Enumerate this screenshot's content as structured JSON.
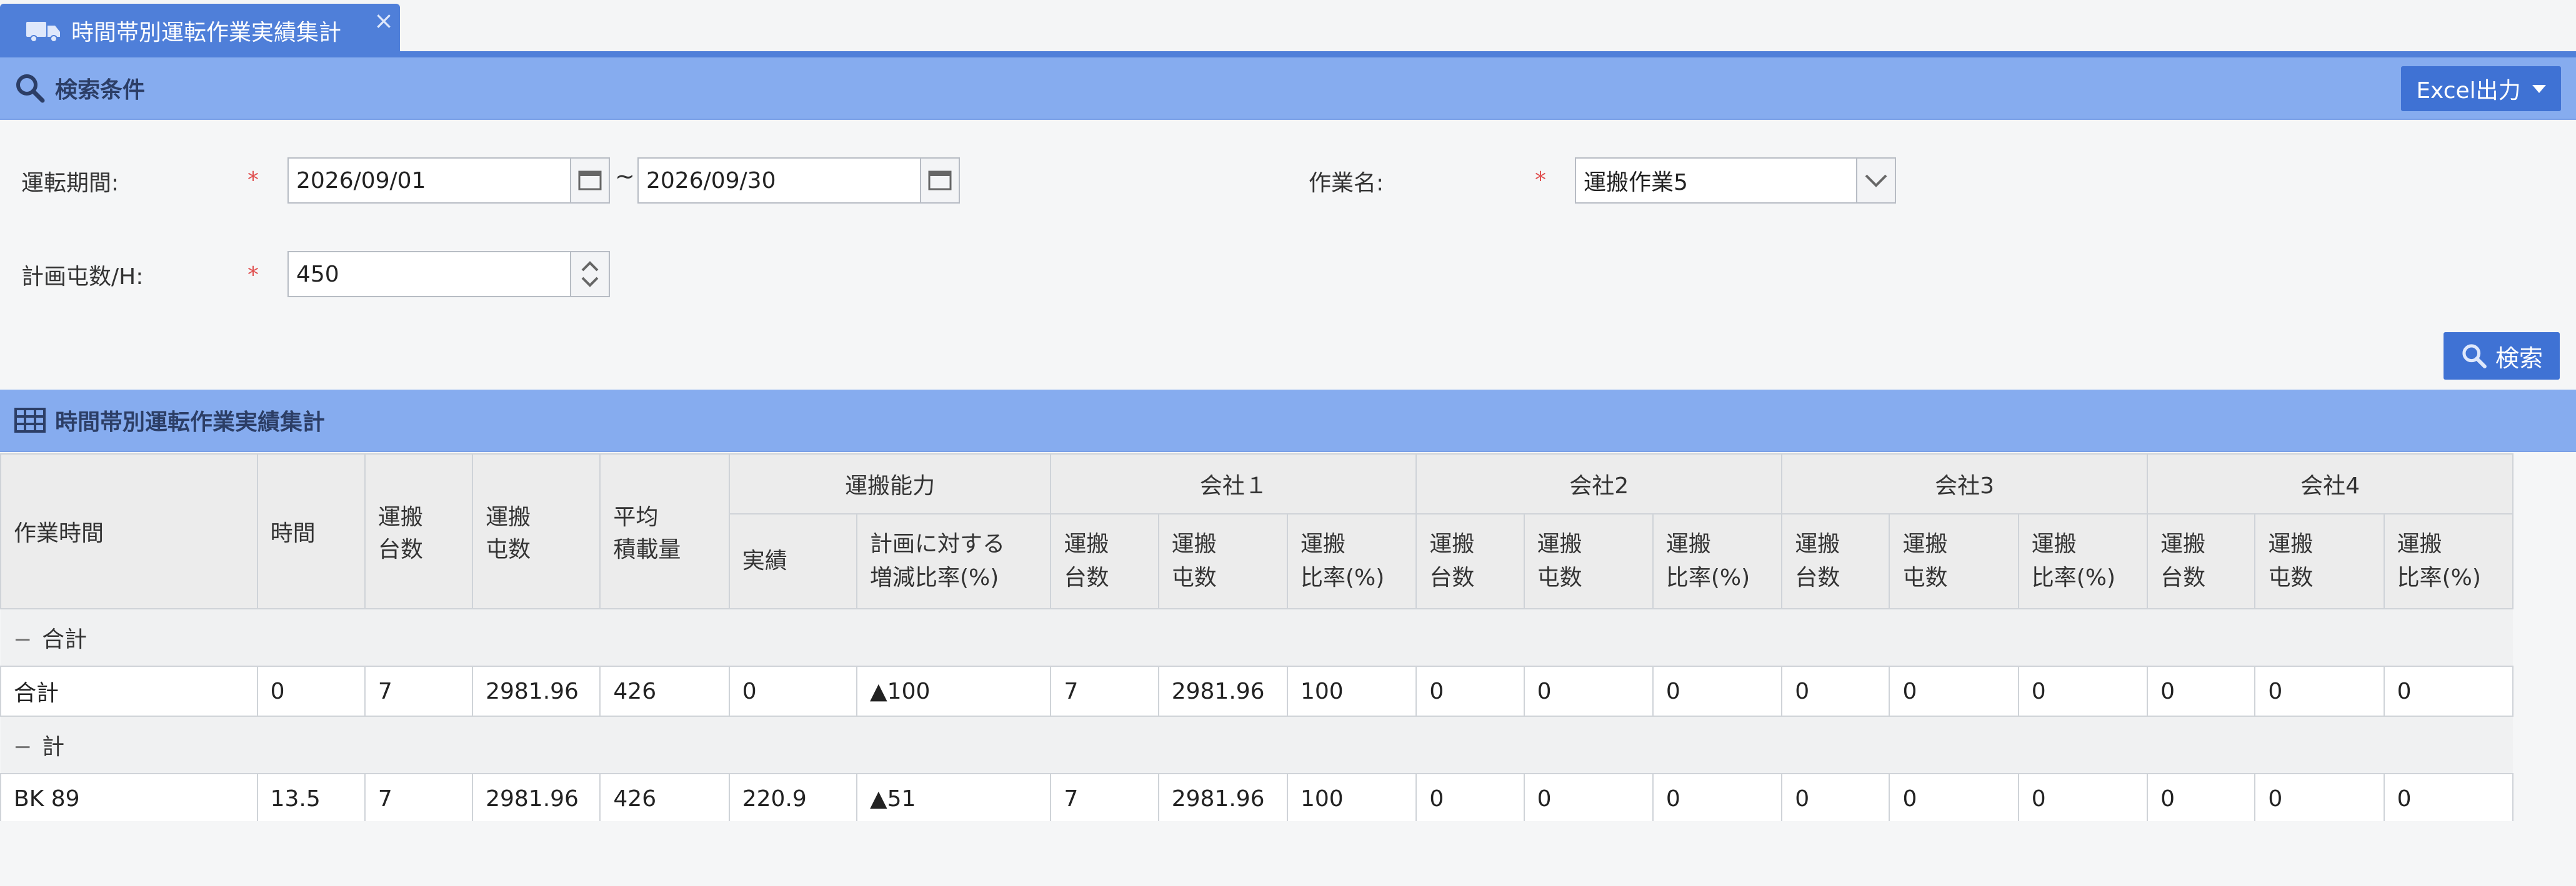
{
  "tab": {
    "title": "時間帯別運転作業実績集計",
    "close": "×"
  },
  "search_section": {
    "title": "検索条件",
    "excel_label": "Excel出力"
  },
  "form": {
    "period_label": "運転期間:",
    "period_from": "2026/09/01",
    "period_sep": "~",
    "period_to": "2026/09/30",
    "work_label": "作業名:",
    "work_value": "運搬作業5",
    "plan_label": "計画屯数/H:",
    "plan_value": "450",
    "required_mark": "*",
    "search_label": "検索"
  },
  "result_section": {
    "title": "時間帯別運転作業実績集計"
  },
  "table": {
    "headers": {
      "work_time": "作業時間",
      "hours": "時間",
      "count": [
        "運搬",
        "台数"
      ],
      "tons": [
        "運搬",
        "屯数"
      ],
      "avg": [
        "平均",
        "積載量"
      ],
      "capacity": "運搬能力",
      "actual": "実績",
      "ratio": [
        "計画に対する",
        "増減比率(%)"
      ],
      "companies": [
        "会社１",
        "会社2",
        "会社3",
        "会社4"
      ],
      "sub_count": [
        "運搬",
        "台数"
      ],
      "sub_tons": [
        "運搬",
        "屯数"
      ],
      "sub_rate": [
        "運搬",
        "比率(%)"
      ]
    },
    "groups": [
      {
        "label": "合計",
        "toggle": "−",
        "rows": [
          [
            "合計",
            "0",
            "7",
            "2981.96",
            "426",
            "0",
            "▲100",
            "7",
            "2981.96",
            "100",
            "0",
            "0",
            "0",
            "0",
            "0",
            "0",
            "0",
            "0",
            "0"
          ]
        ]
      },
      {
        "label": "計",
        "toggle": "−",
        "rows": [
          [
            "BK 89",
            "13.5",
            "7",
            "2981.96",
            "426",
            "220.9",
            "▲51",
            "7",
            "2981.96",
            "100",
            "0",
            "0",
            "0",
            "0",
            "0",
            "0",
            "0",
            "0",
            "0"
          ]
        ]
      }
    ]
  }
}
